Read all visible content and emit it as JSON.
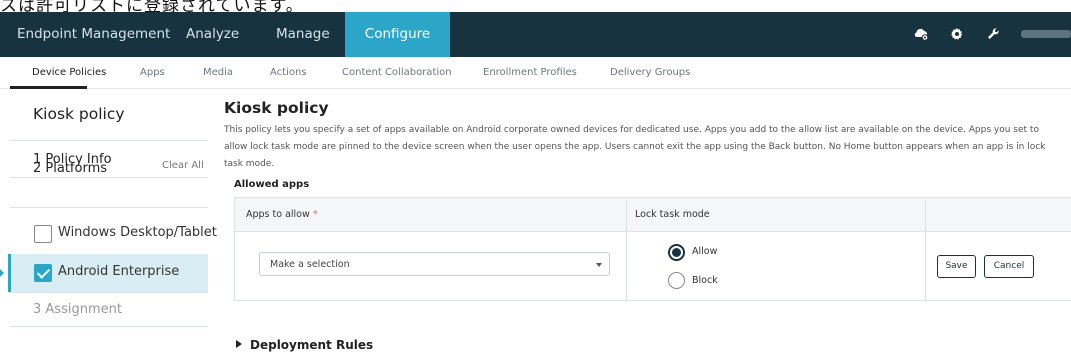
{
  "caption": "スは許可リストに登録されています。",
  "topnav": {
    "items": [
      "Endpoint Management",
      "Analyze",
      "Manage",
      "Configure"
    ],
    "active_index": 3,
    "user_label": ""
  },
  "subnav": {
    "items": [
      "Device Policies",
      "Apps",
      "Media",
      "Actions",
      "Content Collaboration",
      "Enrollment Profiles",
      "Delivery Groups"
    ],
    "active_index": 0
  },
  "sidebar": {
    "title": "Kiosk policy",
    "steps": [
      {
        "label": "1  Policy Info"
      },
      {
        "label": "2  Platforms",
        "action": "Clear All"
      },
      {
        "label": "3  Assignment"
      }
    ],
    "platforms": [
      {
        "label": "Windows Desktop/Tablet",
        "checked": false
      },
      {
        "label": "Android Enterprise",
        "checked": true
      }
    ]
  },
  "main": {
    "title": "Kiosk policy",
    "description": "This policy lets you specify a set of apps available on Android corporate owned devices for dedicated use. Apps you add to the allow list are available on the device. Apps you set to allow lock task mode are pinned to the device screen when the user opens the app. Users cannot exit the app using the Back button. No Home button appears when an app is in lock task mode.",
    "allowed_apps_label": "Allowed apps",
    "table": {
      "col_apps": "Apps to allow",
      "col_apps_required": "*",
      "col_lock": "Lock task mode",
      "select_value": "Make a selection",
      "radio_allow": "Allow",
      "radio_block": "Block",
      "selected_radio": "Allow",
      "save": "Save",
      "cancel": "Cancel"
    },
    "deployment_rules": "Deployment Rules"
  },
  "colors": {
    "nav_bg": "#17333f",
    "accent": "#2ba6c9",
    "selected_bg": "#d9eef4"
  }
}
